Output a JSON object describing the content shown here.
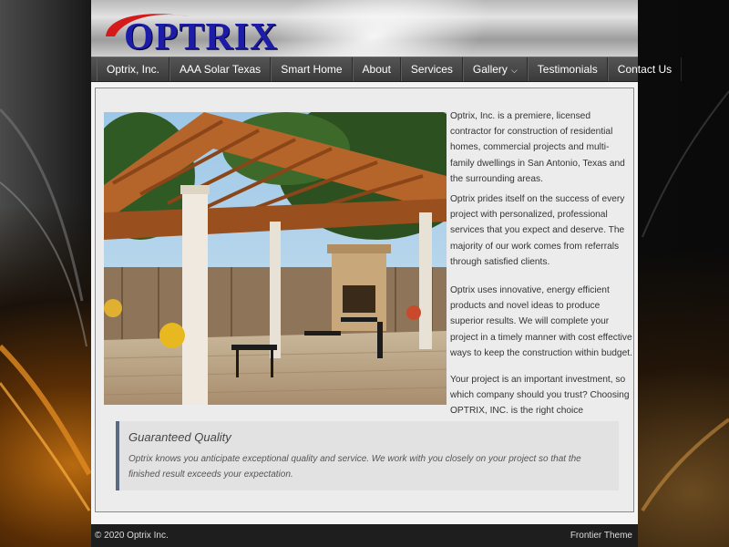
{
  "brand": {
    "logo_text": "OPTRIX",
    "logo_color": "#1c1ca8",
    "swoosh_color": "#d41a1a"
  },
  "nav": {
    "items": [
      {
        "label": "Optrix, Inc."
      },
      {
        "label": "AAA Solar Texas"
      },
      {
        "label": "Smart Home"
      },
      {
        "label": "About"
      },
      {
        "label": "Services"
      },
      {
        "label": "Gallery",
        "icon": "chevron-down-icon"
      },
      {
        "label": "Testimonials"
      },
      {
        "label": "Contact Us"
      }
    ]
  },
  "main": {
    "photo_alt": "pergola-patio-photo",
    "paragraphs": [
      "Optrix, Inc. is a premiere, licensed contractor for construction of residential homes, commercial projects and multi-family dwellings in San Antonio, Texas and the surrounding areas.",
      "Optrix prides itself on the success of every project with personalized, professional services that you expect and deserve.  The majority of our work comes from referrals through satisfied clients.",
      "Optrix uses innovative, energy efficient products and novel ideas to produce superior results.  We will complete your project in a timely manner with cost effective ways to keep the construction within budget.",
      "Your project is an important investment, so which company should you trust?  Choosing OPTRIX, INC. is the right choice"
    ]
  },
  "quote": {
    "title": "Guaranteed Quality",
    "body": "Optrix knows you anticipate exceptional quality and service.  We work with you closely on your project so that the finished result exceeds your expectation."
  },
  "footer": {
    "copyright": "© 2020 Optrix Inc.",
    "theme": "Frontier Theme"
  }
}
